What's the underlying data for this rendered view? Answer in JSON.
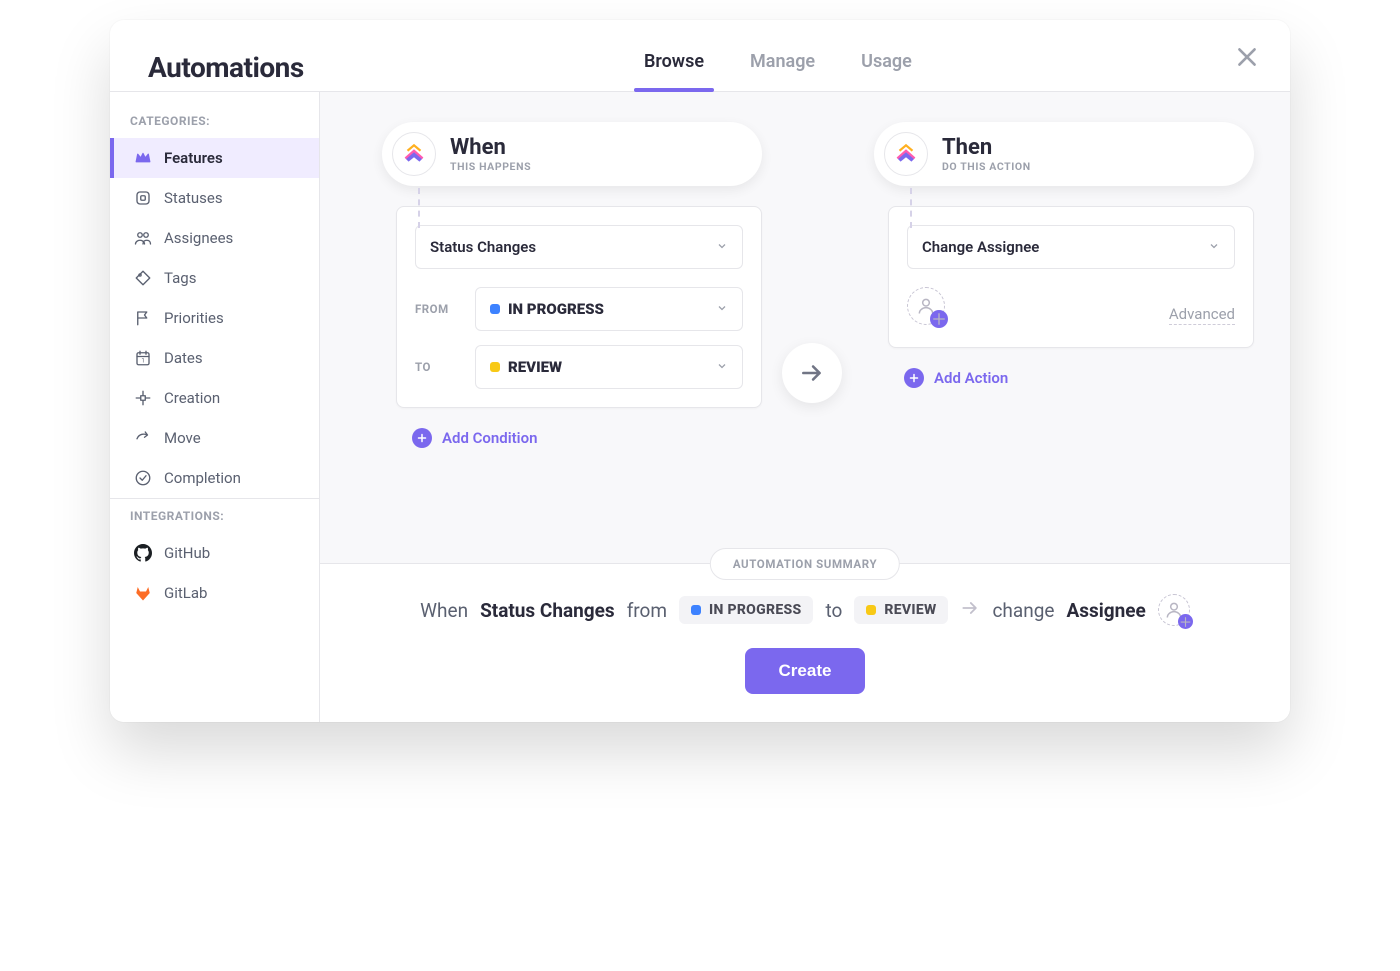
{
  "header": {
    "title": "Automations",
    "tabs": {
      "browse": "Browse",
      "manage": "Manage",
      "usage": "Usage"
    }
  },
  "sidebar": {
    "categories_label": "CATEGORIES:",
    "integrations_label": "INTEGRATIONS:",
    "items": {
      "features": "Features",
      "statuses": "Statuses",
      "assignees": "Assignees",
      "tags": "Tags",
      "priorities": "Priorities",
      "dates": "Dates",
      "creation": "Creation",
      "move": "Move",
      "completion": "Completion"
    },
    "integrations": {
      "github": "GitHub",
      "gitlab": "GitLab"
    }
  },
  "when": {
    "title": "When",
    "subtitle": "THIS HAPPENS",
    "trigger": "Status Changes",
    "from_label": "FROM",
    "from_value": "IN PROGRESS",
    "from_color": "#3d82ff",
    "to_label": "TO",
    "to_value": "REVIEW",
    "to_color": "#f8c916",
    "add_condition": "Add Condition"
  },
  "then": {
    "title": "Then",
    "subtitle": "DO THIS ACTION",
    "action": "Change Assignee",
    "advanced": "Advanced",
    "add_action": "Add Action"
  },
  "summary": {
    "badge": "AUTOMATION SUMMARY",
    "when": "When",
    "trigger": "Status Changes",
    "from": "from",
    "from_value": "IN PROGRESS",
    "to": "to",
    "to_value": "REVIEW",
    "change": "change",
    "assignee": "Assignee",
    "create": "Create"
  }
}
